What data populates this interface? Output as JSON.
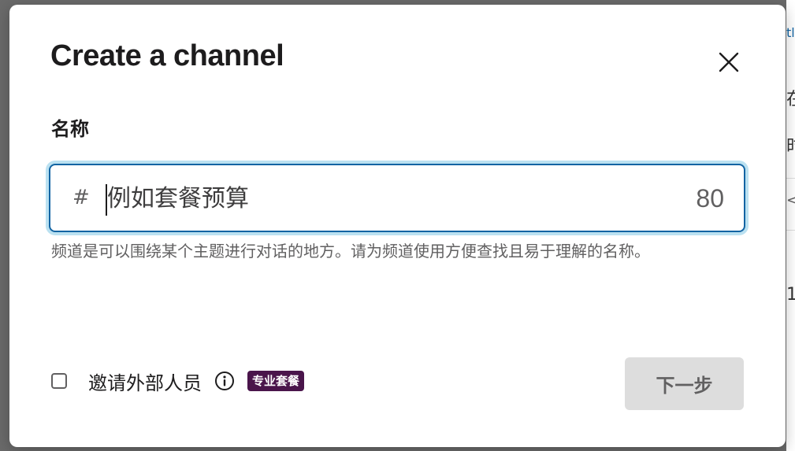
{
  "background": {
    "glyphs": [
      "tl",
      "在",
      "时",
      "<",
      "1"
    ]
  },
  "dialog": {
    "title": "Create a channel",
    "close_icon": "close-icon",
    "name_field": {
      "label": "名称",
      "prefix": "#",
      "value": "",
      "placeholder": "例如套餐预算",
      "char_remaining": "80"
    },
    "help_text": "频道是可以围绕某个主题进行对话的地方。请为频道使用方便查找且易于理解的名称。",
    "invite": {
      "checked": false,
      "label": "邀请外部人员",
      "info_icon": "info-icon",
      "plan_badge": "专业套餐"
    },
    "next_button": "下一步"
  },
  "colors": {
    "focus_border": "#1264a3",
    "badge_bg": "#4a154b",
    "button_disabled_bg": "#dddddd",
    "text_primary": "#1d1c1d",
    "text_secondary": "#616061"
  }
}
